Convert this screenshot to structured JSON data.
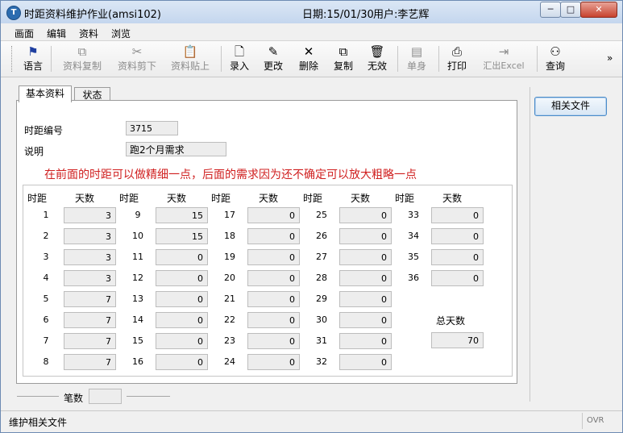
{
  "window": {
    "title": "时距资料维护作业(amsi102)",
    "date": "日期:15/01/30",
    "user": "用户:李艺辉",
    "buttons": {
      "min": "─",
      "max": "□",
      "close": "✕"
    }
  },
  "menu": [
    "画面",
    "编辑",
    "资料",
    "浏览"
  ],
  "toolbar": [
    {
      "label": "语言",
      "icon": "flag-icon",
      "glyph": "⚑",
      "disabled": false
    },
    {
      "label": "资料复制",
      "icon": "copy-data-icon",
      "glyph": "⧉",
      "disabled": true
    },
    {
      "label": "资料剪下",
      "icon": "scissors-icon",
      "glyph": "✂",
      "disabled": true
    },
    {
      "label": "资料贴上",
      "icon": "paste-icon",
      "glyph": "📋",
      "disabled": true
    },
    {
      "label": "录入",
      "icon": "new-document-icon",
      "glyph": "🗋",
      "disabled": false
    },
    {
      "label": "更改",
      "icon": "pencil-icon",
      "glyph": "✎",
      "disabled": false
    },
    {
      "label": "删除",
      "icon": "delete-x-icon",
      "glyph": "✕",
      "disabled": false
    },
    {
      "label": "复制",
      "icon": "copy-icon",
      "glyph": "⧉",
      "disabled": false
    },
    {
      "label": "无效",
      "icon": "trash-icon",
      "glyph": "🗑",
      "disabled": false
    },
    {
      "label": "单身",
      "icon": "detail-icon",
      "glyph": "▤",
      "disabled": true
    },
    {
      "label": "打印",
      "icon": "printer-icon",
      "glyph": "⎙",
      "disabled": false
    },
    {
      "label": "汇出Excel",
      "icon": "export-excel-icon",
      "glyph": "⇥",
      "disabled": true
    },
    {
      "label": "查询",
      "icon": "binoculars-icon",
      "glyph": "⚇",
      "disabled": false
    }
  ],
  "toolbar_more": "»",
  "tabs": [
    "基本资料",
    "状态"
  ],
  "form": {
    "id_label": "时距编号",
    "id_value": "3715",
    "desc_label": "说明",
    "desc_value": "跑2个月需求"
  },
  "note": "在前面的时距可以做精细一点，后面的需求因为还不确定可以放大粗略一点",
  "grid": {
    "col_header": "时距",
    "val_header": "天数",
    "columns": [
      [
        [
          "1",
          "3"
        ],
        [
          "2",
          "3"
        ],
        [
          "3",
          "3"
        ],
        [
          "4",
          "3"
        ],
        [
          "5",
          "7"
        ],
        [
          "6",
          "7"
        ],
        [
          "7",
          "7"
        ],
        [
          "8",
          "7"
        ]
      ],
      [
        [
          "9",
          "15"
        ],
        [
          "10",
          "15"
        ],
        [
          "11",
          "0"
        ],
        [
          "12",
          "0"
        ],
        [
          "13",
          "0"
        ],
        [
          "14",
          "0"
        ],
        [
          "15",
          "0"
        ],
        [
          "16",
          "0"
        ]
      ],
      [
        [
          "17",
          "0"
        ],
        [
          "18",
          "0"
        ],
        [
          "19",
          "0"
        ],
        [
          "20",
          "0"
        ],
        [
          "21",
          "0"
        ],
        [
          "22",
          "0"
        ],
        [
          "23",
          "0"
        ],
        [
          "24",
          "0"
        ]
      ],
      [
        [
          "25",
          "0"
        ],
        [
          "26",
          "0"
        ],
        [
          "27",
          "0"
        ],
        [
          "28",
          "0"
        ],
        [
          "29",
          "0"
        ],
        [
          "30",
          "0"
        ],
        [
          "31",
          "0"
        ],
        [
          "32",
          "0"
        ]
      ],
      [
        [
          "33",
          "0"
        ],
        [
          "34",
          "0"
        ],
        [
          "35",
          "0"
        ],
        [
          "36",
          "0"
        ]
      ]
    ]
  },
  "total": {
    "label": "总天数",
    "value": "70"
  },
  "related_button": "相关文件",
  "count_label": "笔数",
  "count_value": "",
  "status": {
    "text": "维护相关文件",
    "mode": "OVR"
  },
  "colors": {
    "note": "#d02020",
    "readonly_bg": "#ededed"
  }
}
